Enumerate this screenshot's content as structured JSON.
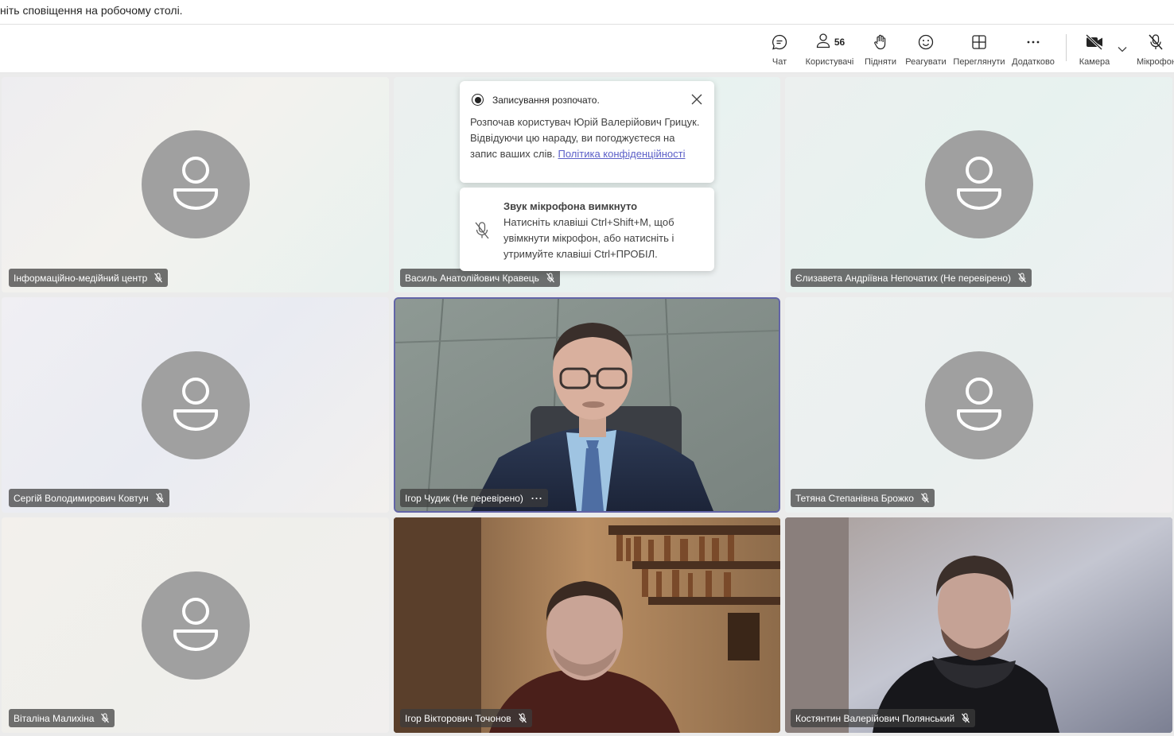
{
  "banner": {
    "text": "ніть сповіщення на робочому столі."
  },
  "toolbar": {
    "chat_label": "Чат",
    "people_label": "Користувачі",
    "people_count": "56",
    "raise_label": "Підняти",
    "react_label": "Реагувати",
    "view_label": "Переглянути",
    "more_label": "Додатково",
    "camera_label": "Камера",
    "mic_label": "Мікрофон"
  },
  "recording_toast": {
    "title": "Записування розпочато.",
    "body": "Розпочав користувач Юрій Валерійович Грицук. Відвідуючи цю нараду, ви погоджуєтеся на запис ваших слів.",
    "link": "Політика конфіденційності"
  },
  "mute_toast": {
    "title": "Звук мікрофона вимкнуто",
    "body": "Натисніть клавіші Ctrl+Shift+M, щоб увімкнути мікрофон, або натисніть і утримуйте клавіші Ctrl+ПРОБІЛ."
  },
  "participants": [
    {
      "name": "Інформаційно-медійний центр",
      "muted": true,
      "video": false
    },
    {
      "name": "Василь Анатолійович Кравець",
      "muted": true,
      "video": false
    },
    {
      "name": "Єлизавета Андріївна Непочатих (Не перевірено)",
      "muted": true,
      "video": false
    },
    {
      "name": "Сергій Володимирович Ковтун",
      "muted": true,
      "video": false
    },
    {
      "name": "Ігор Чудик (Не перевірено)",
      "muted": false,
      "video": true,
      "speaking": true
    },
    {
      "name": "Тетяна Степанівна Брожко",
      "muted": true,
      "video": false
    },
    {
      "name": "Віталіна Малихіна",
      "muted": true,
      "video": false
    },
    {
      "name": "Ігор Вікторович Точонов",
      "muted": true,
      "video": true
    },
    {
      "name": "Костянтин Валерійович Полянський",
      "muted": true,
      "video": true
    }
  ],
  "colors": {
    "accent": "#5b5fc7",
    "speaking_border": "#6264a7"
  },
  "icons": [
    "chat-icon",
    "people-icon",
    "raise-hand-icon",
    "react-icon",
    "view-icon",
    "more-icon",
    "camera-off-icon",
    "chevron-down-icon",
    "mic-off-icon",
    "record-icon",
    "close-icon",
    "person-icon"
  ]
}
